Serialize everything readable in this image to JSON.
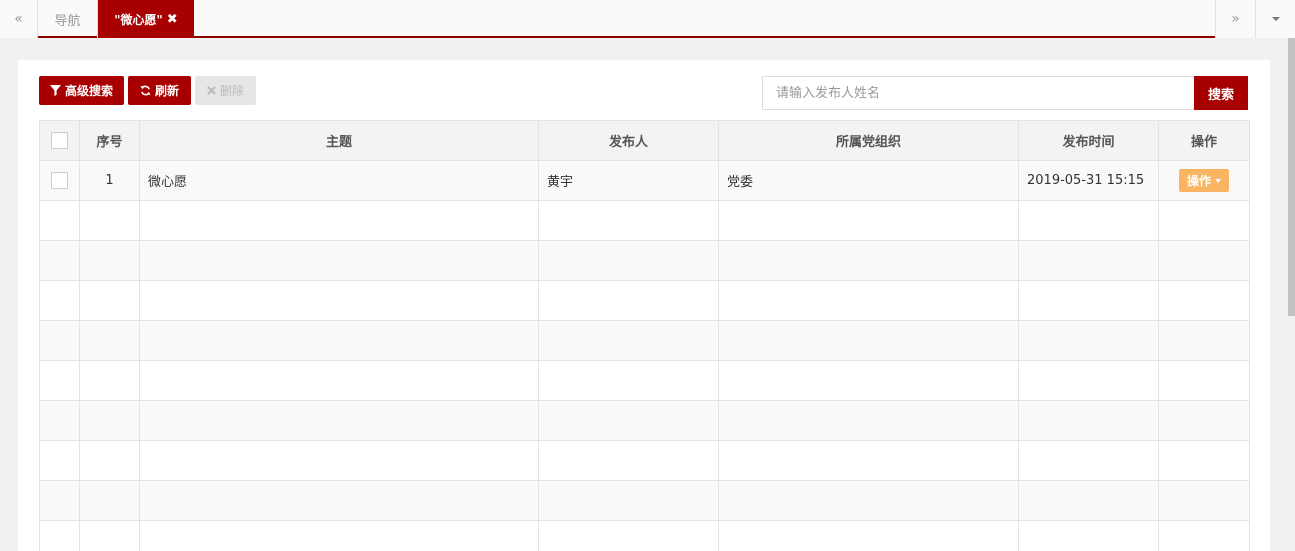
{
  "tabs": {
    "prev_icon": "«",
    "next_icon": "»",
    "nav_label": "导航",
    "active_label": "\"微心愿\"",
    "close_icon": "✖"
  },
  "toolbar": {
    "search_label": "高级搜索",
    "refresh_label": "刷新",
    "delete_label": "删除"
  },
  "search": {
    "placeholder": "请输入发布人姓名",
    "button_label": "搜索"
  },
  "table": {
    "headers": {
      "index": "序号",
      "subject": "主题",
      "publisher": "发布人",
      "org": "所属党组织",
      "time": "发布时间",
      "action": "操作"
    },
    "rows": [
      {
        "index": "1",
        "subject": "微心愿",
        "publisher": "黄宇",
        "org": "党委",
        "time": "2019-05-31 15:15",
        "action": "操作"
      }
    ]
  },
  "colors": {
    "brand": "#a80000",
    "action": "#f9b561"
  }
}
